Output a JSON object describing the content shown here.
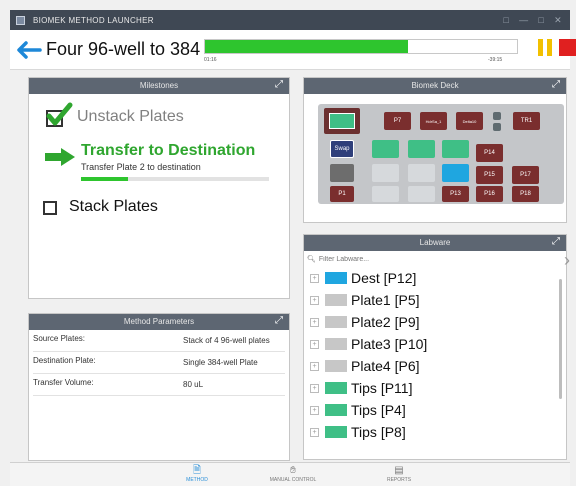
{
  "window": {
    "title": "BIOMEK METHOD LAUNCHER",
    "controls": [
      "□",
      "—",
      "□",
      "✕"
    ]
  },
  "header": {
    "method_name": "Four 96-well to 384",
    "progress_fraction": 0.65,
    "elapsed": "01:16",
    "remaining": "-39:15"
  },
  "milestones": {
    "title": "Milestones",
    "items": [
      {
        "label": "Unstack Plates",
        "state": "done"
      },
      {
        "label": "Transfer to Destination",
        "state": "active",
        "sub": "Transfer Plate 2 to destination",
        "sub_progress": 0.25
      },
      {
        "label": "Stack Plates",
        "state": "pending"
      }
    ]
  },
  "parameters": {
    "title": "Method Parameters",
    "rows": [
      {
        "key": "Source Plates:",
        "value": "Stack of 4 96-well plates"
      },
      {
        "key": "Destination Plate:",
        "value": "Single 384-well Plate"
      },
      {
        "key": "Transfer Volume:",
        "value": "80 uL"
      }
    ]
  },
  "deck": {
    "title": "Biomek Deck",
    "labels": [
      "P7",
      "P14",
      "P15",
      "P17",
      "P1",
      "P13",
      "P16",
      "P18",
      "TR1",
      "Swap"
    ]
  },
  "labware": {
    "title": "Labware",
    "filter_placeholder": "Filter Labware...",
    "items": [
      {
        "name": "Dest [P12]",
        "color": "#1fa6e0"
      },
      {
        "name": "Plate1 [P5]",
        "color": "#c7c7c7"
      },
      {
        "name": "Plate2 [P9]",
        "color": "#c7c7c7"
      },
      {
        "name": "Plate3 [P10]",
        "color": "#c7c7c7"
      },
      {
        "name": "Plate4 [P6]",
        "color": "#c7c7c7"
      },
      {
        "name": "Tips [P11]",
        "color": "#3fbf86"
      },
      {
        "name": "Tips [P4]",
        "color": "#3fbf86"
      },
      {
        "name": "Tips [P8]",
        "color": "#3fbf86"
      }
    ]
  },
  "bottom_nav": {
    "items": [
      {
        "label": "METHOD",
        "active": true
      },
      {
        "label": "MANUAL CONTROL",
        "active": false
      },
      {
        "label": "REPORTS",
        "active": false
      }
    ]
  },
  "colors": {
    "accent_green": "#2ec52e",
    "pause": "#f2c000",
    "stop": "#e02020",
    "panel_header": "#5d6672"
  }
}
